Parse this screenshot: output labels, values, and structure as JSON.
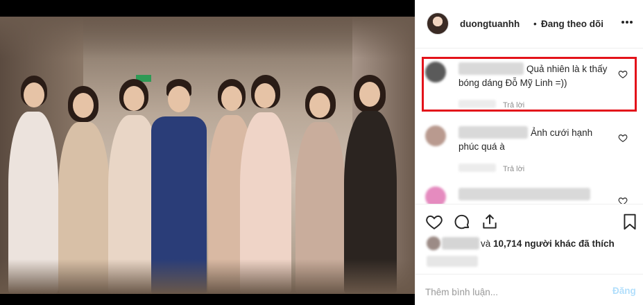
{
  "header": {
    "username": "duongtuanhh",
    "separator": "•",
    "follow_status": "Đang theo dõi",
    "more_icon": "more-horizontal-icon"
  },
  "comments": [
    {
      "text": "Quả nhiên là k thấy bóng dáng Đỗ Mỹ Linh =))",
      "reply_label": "Trả lời",
      "highlighted": true
    },
    {
      "text": "Ảnh cưới hạnh phúc quá à",
      "reply_label": "Trả lời",
      "highlighted": false
    }
  ],
  "actions": {
    "like_icon": "heart-icon",
    "comment_icon": "comment-bubble-icon",
    "share_icon": "share-icon",
    "save_icon": "bookmark-icon",
    "likes_prefix": "và",
    "likes_count": "10,714",
    "likes_suffix": "người khác đã thích"
  },
  "comment_box": {
    "placeholder": "Thêm bình luận...",
    "post_label": "Đăng"
  },
  "colors": {
    "highlight_border": "#e3121a",
    "post_button_disabled": "#b2dffc",
    "muted_text": "#8e8e8e"
  }
}
